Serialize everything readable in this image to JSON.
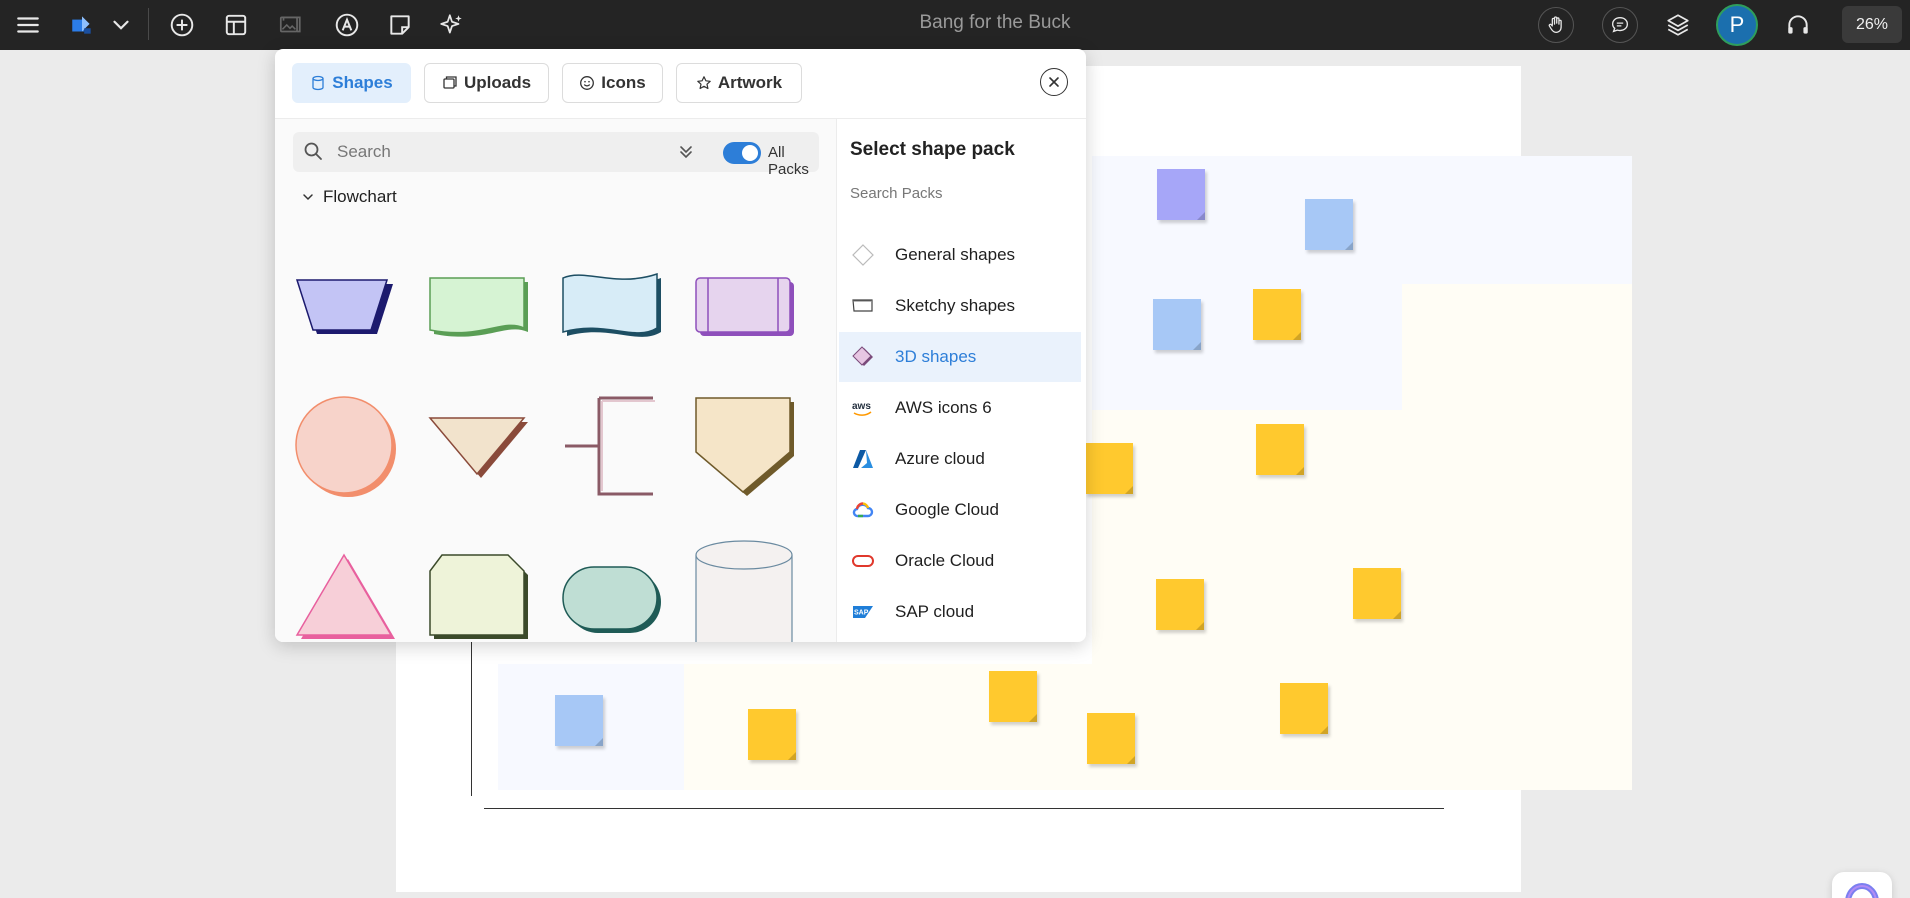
{
  "topbar": {
    "title": "Bang for the Buck",
    "avatar_initial": "P",
    "zoom": "26%"
  },
  "panel": {
    "tabs": [
      {
        "label": "Shapes",
        "icon": "cylinder-icon",
        "active": true
      },
      {
        "label": "Uploads",
        "icon": "images-icon",
        "active": false
      },
      {
        "label": "Icons",
        "icon": "smiley-icon",
        "active": false
      },
      {
        "label": "Artwork",
        "icon": "star-icon",
        "active": false
      }
    ],
    "search": {
      "placeholder": "Search"
    },
    "all_packs_label": "All Packs",
    "section_title": "Flowchart",
    "pack_panel": {
      "title": "Select shape pack",
      "search_placeholder": "Search Packs",
      "packs": [
        {
          "label": "General shapes",
          "icon": "diamond-outline-icon"
        },
        {
          "label": "Sketchy shapes",
          "icon": "sketchy-rectangle-icon"
        },
        {
          "label": "3D shapes",
          "icon": "3d-diamond-icon",
          "active": true
        },
        {
          "label": "AWS icons 6",
          "icon": "aws-icon"
        },
        {
          "label": "Azure cloud",
          "icon": "azure-icon"
        },
        {
          "label": "Google Cloud",
          "icon": "google-cloud-icon"
        },
        {
          "label": "Oracle Cloud",
          "icon": "oracle-icon"
        },
        {
          "label": "SAP cloud",
          "icon": "sap-icon"
        }
      ]
    }
  },
  "colors": {
    "accent": "#2d7ed8",
    "topbar": "#242424",
    "sticky_yellow": "#ffc92e",
    "sticky_blue": "#a7c8f6",
    "sticky_purple": "#a6a6f8"
  }
}
